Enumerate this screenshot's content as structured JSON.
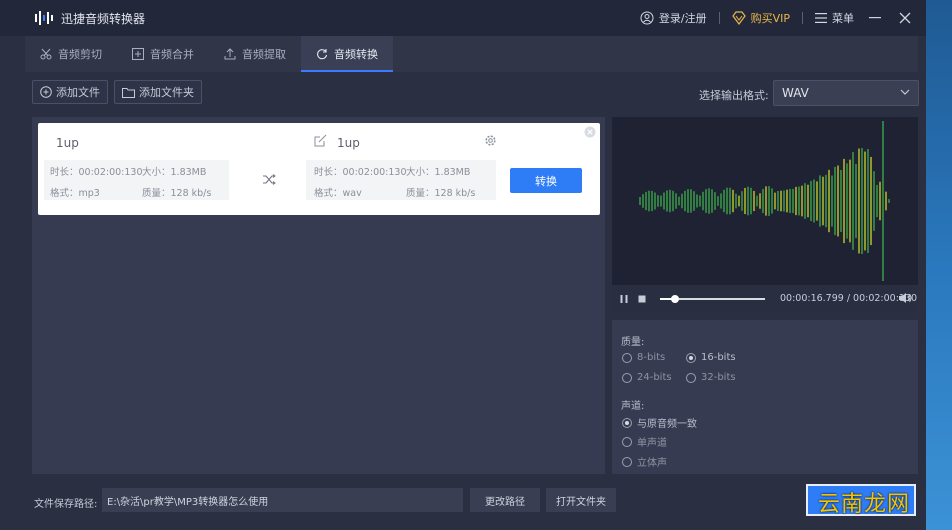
{
  "app": {
    "title": "迅捷音频转换器"
  },
  "titlebar": {
    "login": "登录/注册",
    "vip": "购买VIP",
    "menu": "菜单"
  },
  "tabs": [
    {
      "label": "音频剪切",
      "icon": "scissors-icon"
    },
    {
      "label": "音频合并",
      "icon": "merge-icon"
    },
    {
      "label": "音频提取",
      "icon": "upload-icon"
    },
    {
      "label": "音频转换",
      "icon": "refresh-icon",
      "active": true
    }
  ],
  "toolbar": {
    "add_file": "添加文件",
    "add_folder": "添加文件夹",
    "format_label": "选择输出格式:",
    "format_value": "WAV"
  },
  "file_card": {
    "source": {
      "name": "1up",
      "duration": "时长：00:02:00:130",
      "size": "大小：1.83MB",
      "format": "格式：mp3",
      "quality": "质量：128 kb/s"
    },
    "target": {
      "name": "1up",
      "duration": "时长：00:02:00:130",
      "size": "大小：1.83MB",
      "format": "格式：wav",
      "quality": "质量：128 kb/s"
    },
    "convert_label": "转换"
  },
  "player": {
    "time": "00:00:16.799 / 00:02:00:130",
    "progress": 0.14
  },
  "settings": {
    "quality_label": "质量:",
    "quality_options": [
      "8-bits",
      "16-bits",
      "24-bits",
      "32-bits"
    ],
    "quality_selected": "16-bits",
    "channel_label": "声道:",
    "channel_options": [
      "与原音频一致",
      "单声道",
      "立体声"
    ],
    "channel_selected": "与原音频一致"
  },
  "bottom": {
    "path_label": "文件保存路径:",
    "path_value": "E:\\杂活\\pr教学\\MP3转换器怎么使用",
    "change_path": "更改路径",
    "open_folder": "打开文件夹"
  },
  "watermark": "云南龙网",
  "colors": {
    "accent": "#2e7cf6",
    "vip": "#e8b84a",
    "wave_green": "#3aa64a",
    "wave_yellow": "#c4c82a"
  }
}
